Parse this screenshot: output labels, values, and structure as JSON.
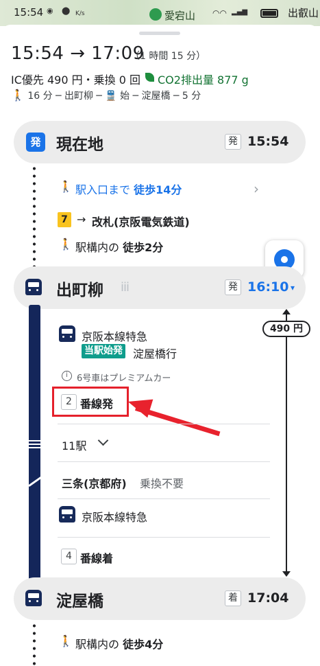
{
  "status_bar": {
    "time": "15:54",
    "net_speed": "K/s",
    "place": "愛宕山",
    "right_text": "出叡山"
  },
  "header": {
    "depart_time": "15:54",
    "arrow": "→",
    "arrive_time": "17:09",
    "duration": "（1 時間 15 分）",
    "fare": "IC優先 490 円・乗換 0 回",
    "co2": "CO2排出量 877 g",
    "summary": "16 分 ─ 出町柳 ─ 🚆 始 ─ 淀屋橋 ─ 5 分"
  },
  "origin": {
    "badge": "発",
    "name": "現在地",
    "chip": "発",
    "time": "15:54"
  },
  "walk_to_station": {
    "label": "駅入口まで",
    "emph": "徒歩14分"
  },
  "gate": {
    "number": "7",
    "arrow": "→",
    "label": "改札(京阪電気鉄道)"
  },
  "walk_in_station_1": {
    "label": "駅構内の",
    "emph": "徒歩2分"
  },
  "station_1": {
    "name": "出町柳",
    "crowd": "iii",
    "chip": "発",
    "time": "16:10",
    "caret": "▾"
  },
  "train": {
    "line": "京阪本線特急",
    "origin_tag": "当駅始発",
    "destination": "淀屋橋行",
    "note": "6号車はプレミアムカー",
    "platform_number": "2",
    "platform_label": "番線発",
    "stops": "11駅",
    "fare_badge": "490 円"
  },
  "transfer_stop": {
    "name": "三条(京都府)",
    "note": "乗換不要"
  },
  "train_2": {
    "line": "京阪本線特急"
  },
  "arrival_platform": {
    "number": "4",
    "label": "番線着"
  },
  "station_2": {
    "name": "淀屋橋",
    "chip": "着",
    "time": "17:04"
  },
  "walk_in_station_2": {
    "label": "駅構内の",
    "emph": "徒歩4分"
  },
  "colors": {
    "accent_blue": "#1a73e8",
    "rail_navy": "#14265a",
    "co2_green": "#137333",
    "annotation_red": "#e5202b",
    "origin_tag_teal": "#0f9d8c",
    "exit_yellow": "#f9c31f"
  },
  "icons": [
    "walk-icon",
    "train-icon",
    "info-icon",
    "chevron-right-icon",
    "chevron-down-icon",
    "my-location-icon",
    "leaf-icon",
    "crowd-icon"
  ]
}
